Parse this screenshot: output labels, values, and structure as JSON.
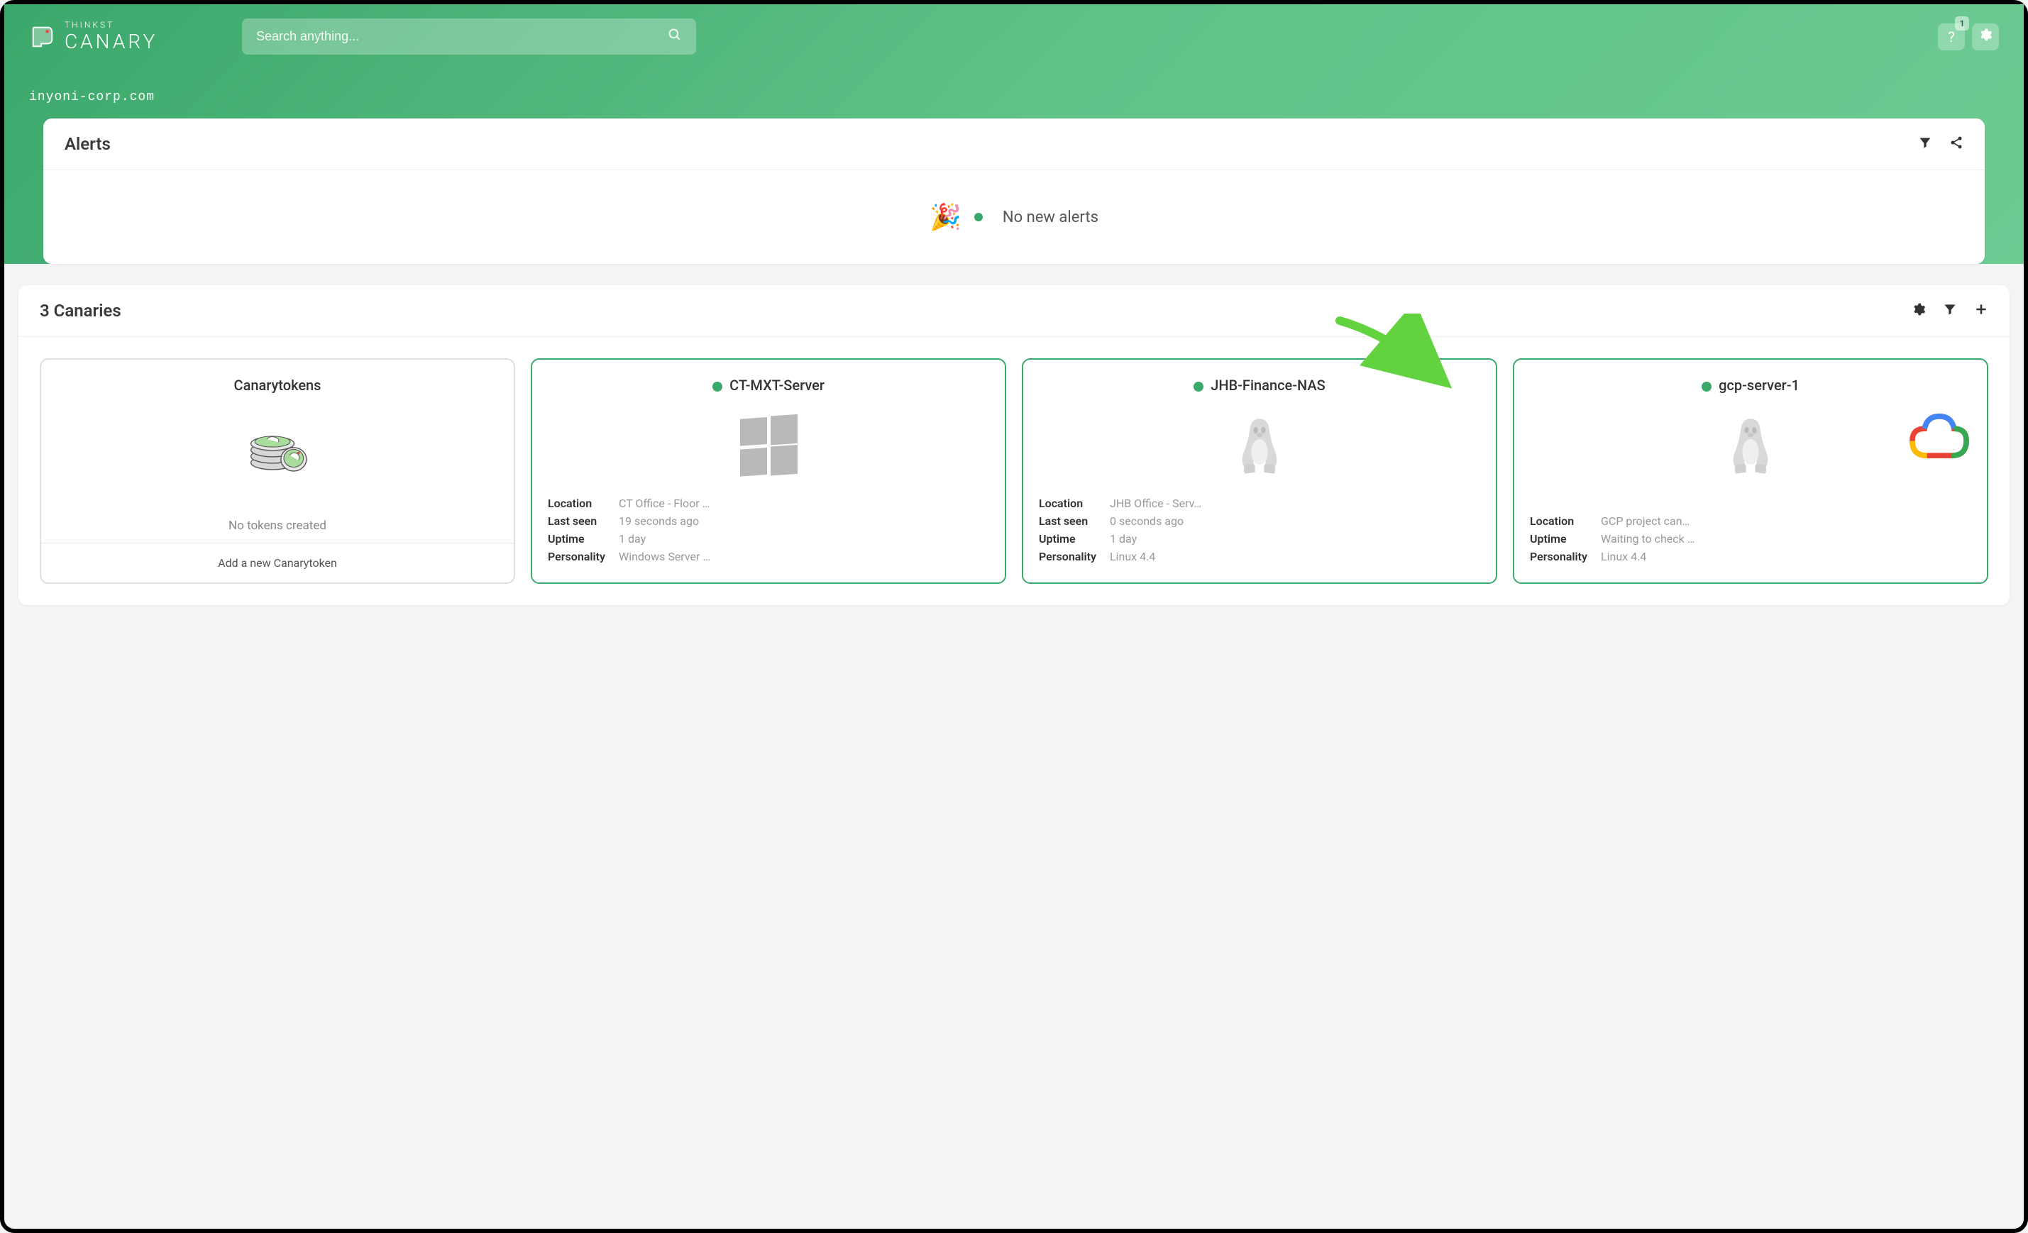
{
  "brand": {
    "small": "THINKST",
    "big": "CANARY"
  },
  "search": {
    "placeholder": "Search anything..."
  },
  "topbar": {
    "notification_count": "1"
  },
  "domain": "inyoni-corp.com",
  "alerts": {
    "title": "Alerts",
    "empty_text": "No new alerts"
  },
  "canaries": {
    "title": "3 Canaries",
    "tokens_card": {
      "title": "Canarytokens",
      "empty_text": "No tokens created",
      "add_label": "Add a new Canarytoken"
    },
    "stat_labels": {
      "location": "Location",
      "last_seen": "Last seen",
      "uptime": "Uptime",
      "personality": "Personality"
    },
    "items": [
      {
        "name": "CT-MXT-Server",
        "os": "windows",
        "location": "CT Office - Floor …",
        "last_seen": "19 seconds ago",
        "uptime": "1 day",
        "personality": "Windows Server …"
      },
      {
        "name": "JHB-Finance-NAS",
        "os": "linux",
        "location": "JHB Office - Serv…",
        "last_seen": "0 seconds ago",
        "uptime": "1 day",
        "personality": "Linux 4.4"
      },
      {
        "name": "gcp-server-1",
        "os": "linux",
        "cloud": "gcp",
        "location": "GCP project can…",
        "uptime": "Waiting to check …",
        "personality": "Linux 4.4"
      }
    ]
  },
  "colors": {
    "accent": "#3ba86b"
  }
}
